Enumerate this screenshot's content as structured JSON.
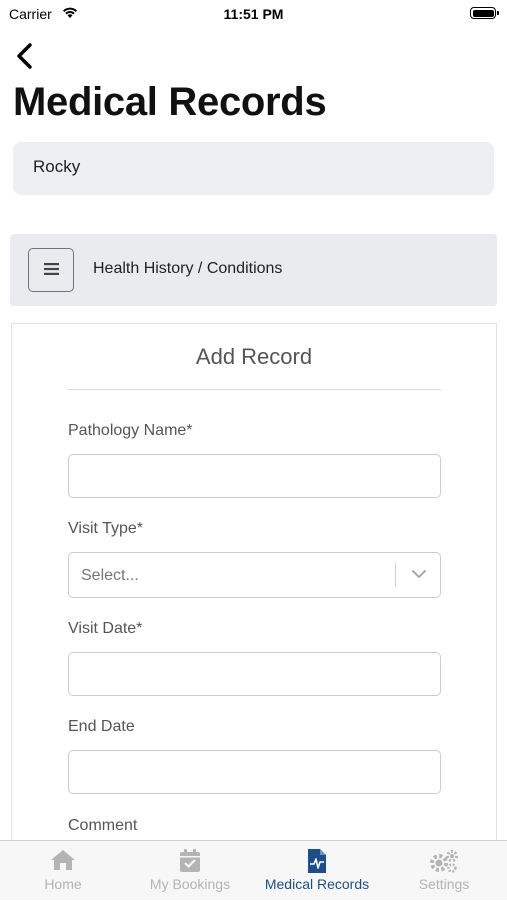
{
  "status_bar": {
    "carrier": "Carrier",
    "time": "11:51 PM"
  },
  "header": {
    "title": "Medical Records"
  },
  "pet": {
    "name": "Rocky"
  },
  "section": {
    "label": "Health History / Conditions"
  },
  "form": {
    "title": "Add Record",
    "pathology_label": "Pathology Name*",
    "pathology_value": "",
    "visit_type_label": "Visit Type*",
    "visit_type_placeholder": "Select...",
    "visit_date_label": "Visit Date*",
    "visit_date_value": "",
    "end_date_label": "End Date",
    "end_date_value": "",
    "comment_label": "Comment"
  },
  "tabs": [
    {
      "label": "Home",
      "icon": "home-icon"
    },
    {
      "label": "My Bookings",
      "icon": "calendar-check-icon"
    },
    {
      "label": "Medical Records",
      "icon": "medical-file-icon",
      "active": true
    },
    {
      "label": "Settings",
      "icon": "gears-icon"
    }
  ],
  "colors": {
    "accent": "#1b4e8a",
    "inactive_tab": "#b4b4b4",
    "section_bg": "#e9ebee"
  }
}
